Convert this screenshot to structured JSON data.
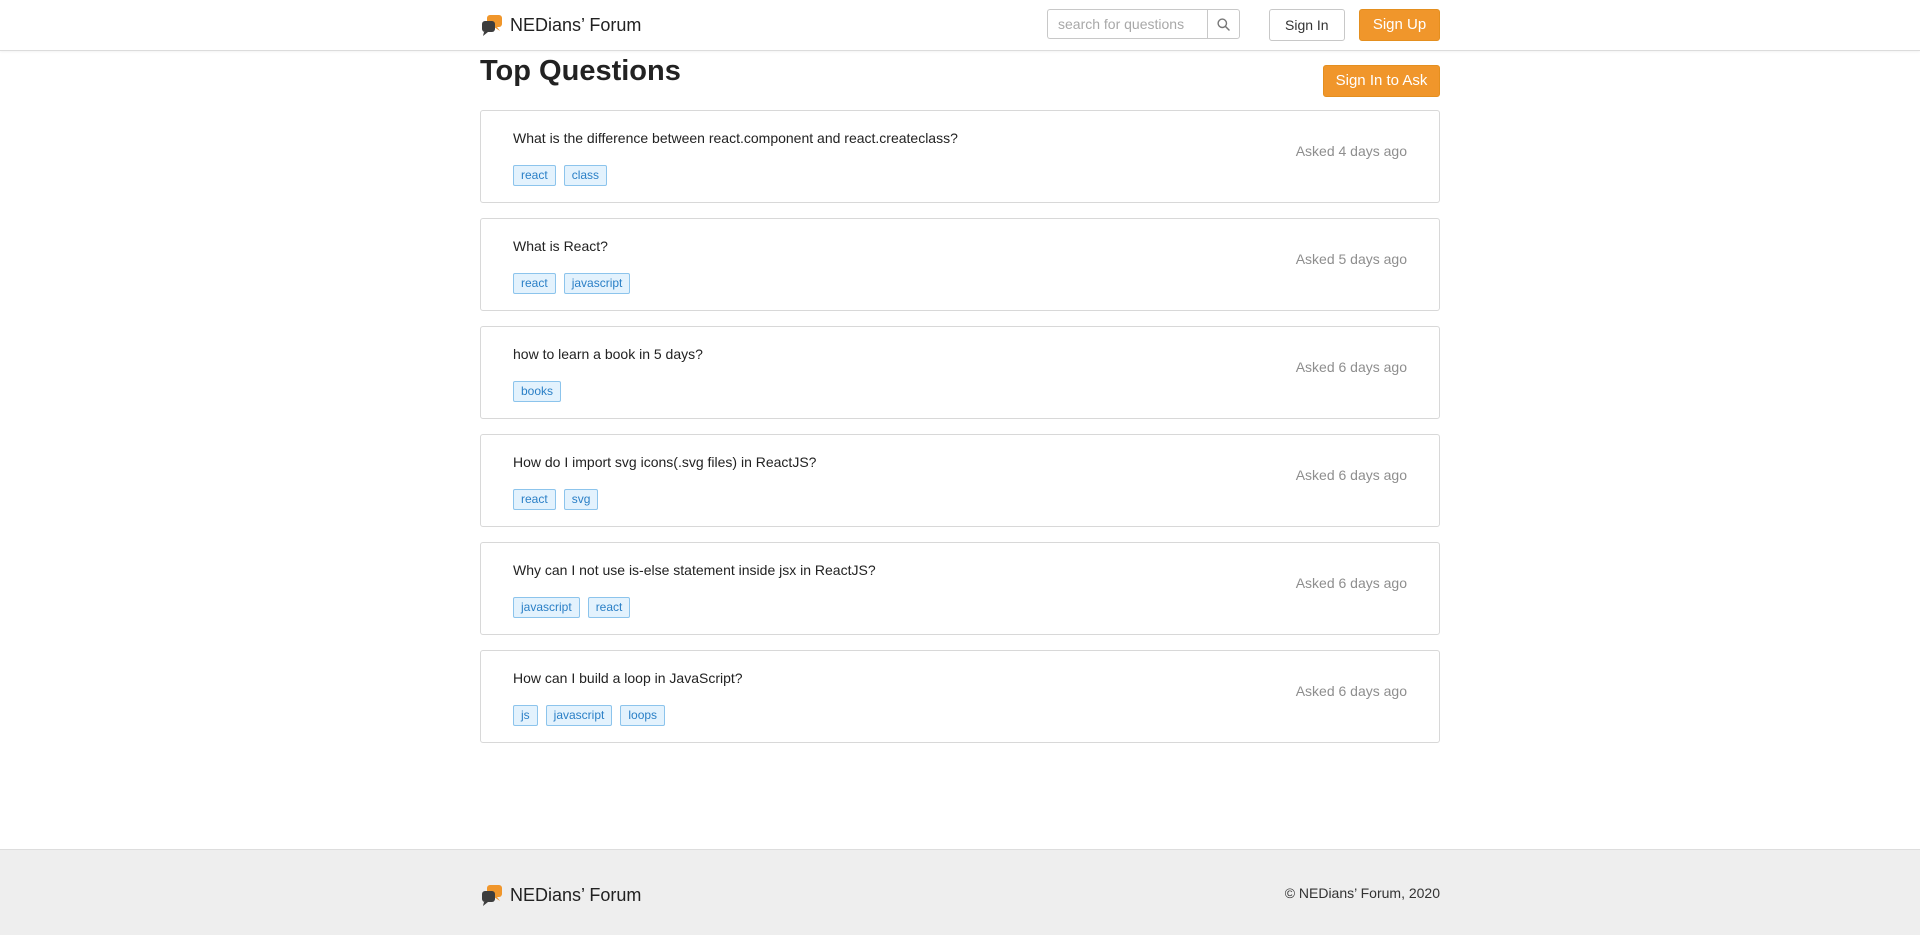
{
  "header": {
    "brand": "NEDians’ Forum",
    "search_placeholder": "search for questions",
    "sign_in": "Sign In",
    "sign_up": "Sign Up"
  },
  "main": {
    "title": "Top Questions",
    "ask_button": "Sign In to Ask",
    "questions": [
      {
        "title": "What is the difference between react.component and react.createclass?",
        "tags": [
          "react",
          "class"
        ],
        "asked": "Asked 4 days ago"
      },
      {
        "title": "What is React?",
        "tags": [
          "react",
          "javascript"
        ],
        "asked": "Asked 5 days ago"
      },
      {
        "title": "how to learn a book in 5 days?",
        "tags": [
          "books"
        ],
        "asked": "Asked 6 days ago"
      },
      {
        "title": "How do I import svg icons(.svg files) in ReactJS?",
        "tags": [
          "react",
          "svg"
        ],
        "asked": "Asked 6 days ago"
      },
      {
        "title": "Why can I not use is-else statement inside jsx in ReactJS?",
        "tags": [
          "javascript",
          "react"
        ],
        "asked": "Asked 6 days ago"
      },
      {
        "title": "How can I build a loop in JavaScript?",
        "tags": [
          "js",
          "javascript",
          "loops"
        ],
        "asked": "Asked 6 days ago"
      }
    ]
  },
  "footer": {
    "brand": "NEDians’ Forum",
    "copyright": "© NEDians’ Forum, 2020"
  },
  "colors": {
    "accent": "#f0962b",
    "tag_text": "#2a7fc6",
    "tag_bg": "#e3f2fd",
    "logo_dark": "#3d3d3d"
  },
  "icons": {
    "logo": "chat-bubbles-icon",
    "search": "search-icon"
  }
}
